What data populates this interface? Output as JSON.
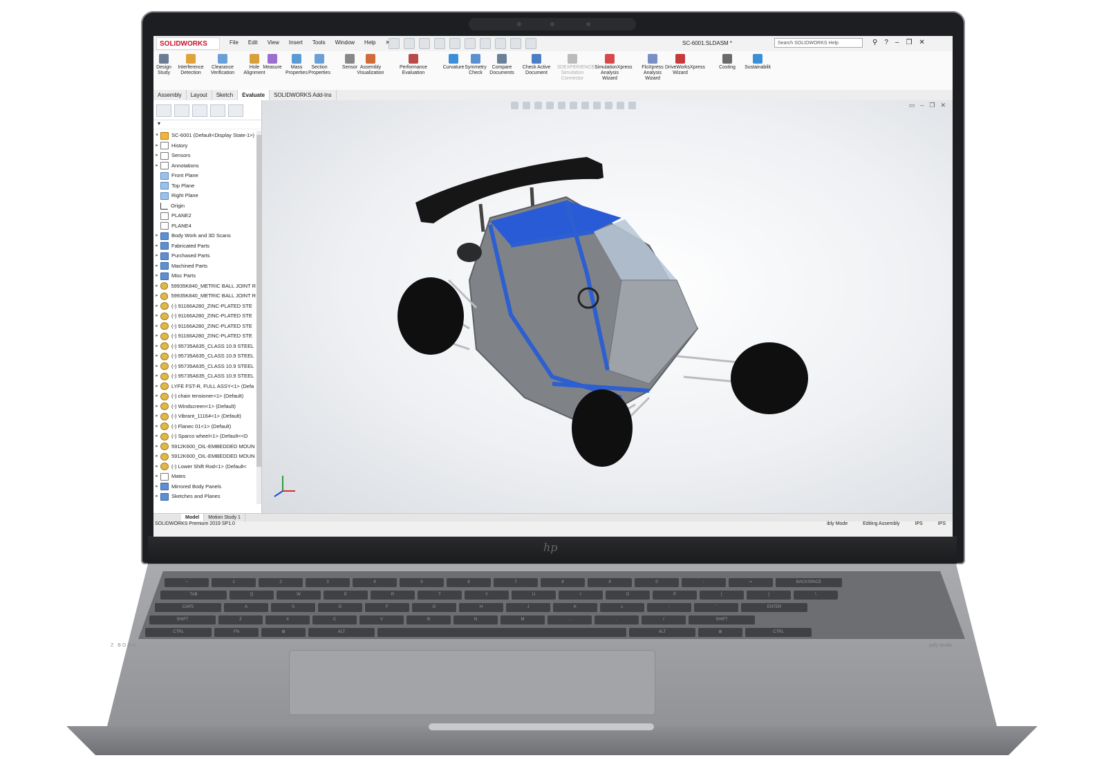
{
  "app": {
    "brand": "SOLIDWORKS",
    "document_title": "SC-6001.SLDASM *",
    "search_placeholder": "Search SOLIDWORKS Help",
    "menu": [
      "File",
      "Edit",
      "View",
      "Insert",
      "Tools",
      "Window",
      "Help"
    ]
  },
  "ribbon": {
    "design_study": "Design Study",
    "items": [
      "Interference Detection",
      "Clearance Verification",
      "Hole Alignment",
      "Measure",
      "Mass Properties",
      "Section Properties",
      "Sensor",
      "Assembly Visualization",
      "Performance Evaluation",
      "Curvature",
      "Symmetry Check",
      "Compare Documents",
      "Check Active Document",
      "3DEXPERIENCE Simulation Connector",
      "SimulationXpress Analysis Wizard",
      "FloXpress Analysis Wizard",
      "DriveWorksXpress Wizard",
      "Costing",
      "Sustainabilit"
    ]
  },
  "tabs": [
    "Assembly",
    "Layout",
    "Sketch",
    "Evaluate",
    "SOLIDWORKS Add-Ins"
  ],
  "active_tab": "Evaluate",
  "tree": {
    "root": "SC-6001 (Default<Display State-1>)",
    "items": [
      {
        "label": "History",
        "kind": "misc"
      },
      {
        "label": "Sensors",
        "kind": "misc"
      },
      {
        "label": "Annotations",
        "kind": "misc"
      },
      {
        "label": "Front Plane",
        "kind": "plane"
      },
      {
        "label": "Top Plane",
        "kind": "plane"
      },
      {
        "label": "Right Plane",
        "kind": "plane"
      },
      {
        "label": "Origin",
        "kind": "origin"
      },
      {
        "label": "PLANE2",
        "kind": "misc"
      },
      {
        "label": "PLANE4",
        "kind": "misc"
      },
      {
        "label": "Body Work and 3D Scans",
        "kind": "folder"
      },
      {
        "label": "Fabricated Parts",
        "kind": "folder"
      },
      {
        "label": "Purchased Parts",
        "kind": "folder"
      },
      {
        "label": "Machined Parts",
        "kind": "folder"
      },
      {
        "label": "Misc Parts",
        "kind": "folder"
      },
      {
        "label": "59935K840_METRIC BALL JOINT R",
        "kind": "part"
      },
      {
        "label": "59935K840_METRIC BALL JOINT R",
        "kind": "part"
      },
      {
        "label": "(-) 91166A280_ZINC-PLATED STE",
        "kind": "part"
      },
      {
        "label": "(-) 91166A280_ZINC-PLATED STE",
        "kind": "part"
      },
      {
        "label": "(-) 91166A280_ZINC-PLATED STE",
        "kind": "part"
      },
      {
        "label": "(-) 91166A280_ZINC-PLATED STE",
        "kind": "part"
      },
      {
        "label": "(-) 95735A635_CLASS 10.9 STEEL",
        "kind": "part"
      },
      {
        "label": "(-) 95735A635_CLASS 10.9 STEEL",
        "kind": "part"
      },
      {
        "label": "(-) 95735A635_CLASS 10.9 STEEL",
        "kind": "part"
      },
      {
        "label": "(-) 95735A635_CLASS 10.9 STEEL",
        "kind": "part"
      },
      {
        "label": "LYFE FST-R, FULL ASSY<1> (Defa",
        "kind": "part"
      },
      {
        "label": "(-) chain tensioner<1> (Default)",
        "kind": "part"
      },
      {
        "label": "(-) Windscreen<1> (Default)",
        "kind": "part"
      },
      {
        "label": "(-) Vibrant_11164<1> (Default)",
        "kind": "part"
      },
      {
        "label": "(-) Flanec 01<1> (Default)",
        "kind": "part"
      },
      {
        "label": "(-) Sparco wheel<1> (Default<<D",
        "kind": "part"
      },
      {
        "label": "5912K600_OIL-EMBEDDED MOUN",
        "kind": "part"
      },
      {
        "label": "5912K600_OIL-EMBEDDED MOUN",
        "kind": "part"
      },
      {
        "label": "(-) Lower Shift Rod<1> (Default<",
        "kind": "part"
      },
      {
        "label": "Mates",
        "kind": "misc"
      },
      {
        "label": "Mirrored Body Panels",
        "kind": "folder"
      },
      {
        "label": "Sketches and Planes",
        "kind": "folder"
      }
    ]
  },
  "bottom_tabs": [
    "Model",
    "Motion Study 1"
  ],
  "status": {
    "left": "SOLIDWORKS Premium 2019 SP1.0",
    "mode": "ibly Mode",
    "editing": "Editing Assembly",
    "units1": "IPS",
    "units2": "IPS"
  },
  "laptop": {
    "logo": "hp",
    "series": "Z BOOK",
    "model": "poly studio"
  },
  "keyboard_rows": [
    [
      "~",
      "1",
      "2",
      "3",
      "4",
      "5",
      "6",
      "7",
      "8",
      "9",
      "0",
      "-",
      "=",
      "BACKSPACE"
    ],
    [
      "TAB",
      "Q",
      "W",
      "E",
      "R",
      "T",
      "Y",
      "U",
      "I",
      "O",
      "P",
      "[",
      "]",
      "\\"
    ],
    [
      "CAPS",
      "A",
      "S",
      "D",
      "F",
      "G",
      "H",
      "J",
      "K",
      "L",
      ";",
      "'",
      "ENTER"
    ],
    [
      "SHIFT",
      "Z",
      "X",
      "C",
      "V",
      "B",
      "N",
      "M",
      ",",
      ".",
      "/",
      "SHIFT"
    ],
    [
      "CTRL",
      "FN",
      "⊞",
      "ALT",
      "",
      "ALT",
      "⊞",
      "CTRL"
    ]
  ],
  "colors": {
    "brand_red": "#c8102e",
    "frame_blue": "#2d5fd0",
    "body_gray": "#8e9196"
  }
}
